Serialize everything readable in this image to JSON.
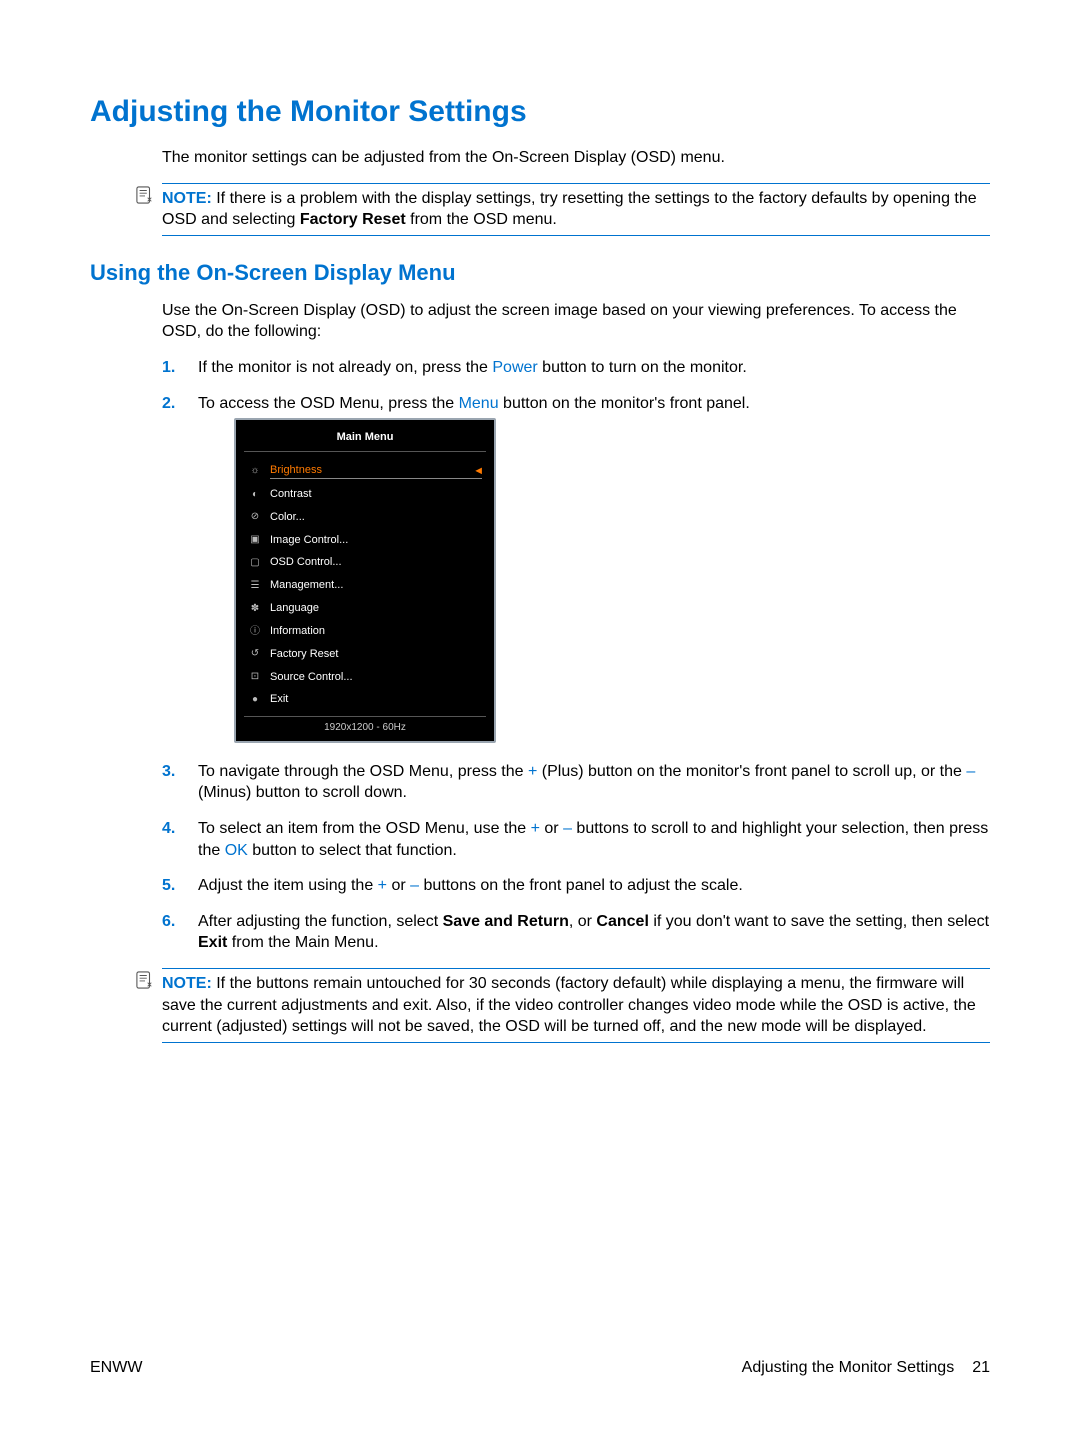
{
  "title": "Adjusting the Monitor Settings",
  "intro": "The monitor settings can be adjusted from the On-Screen Display (OSD) menu.",
  "note1": {
    "label": "NOTE:",
    "segments": [
      {
        "t": "If there is a problem with the display settings, try resetting the settings to the factory defaults by opening the OSD and selecting "
      },
      {
        "t": "Factory Reset",
        "bold": true
      },
      {
        "t": " from the OSD menu."
      }
    ]
  },
  "sub_title": "Using the On-Screen Display Menu",
  "sub_intro": "Use the On-Screen Display (OSD) to adjust the screen image based on your viewing preferences. To access the OSD, do the following:",
  "steps": [
    {
      "n": "1.",
      "segments": [
        {
          "t": "If the monitor is not already on, press the "
        },
        {
          "t": "Power",
          "kw": true
        },
        {
          "t": " button to turn on the monitor."
        }
      ]
    },
    {
      "n": "2.",
      "segments": [
        {
          "t": "To access the OSD Menu, press the "
        },
        {
          "t": "Menu",
          "kw": true
        },
        {
          "t": " button on the monitor's front panel."
        }
      ]
    },
    {
      "n": "3.",
      "segments": [
        {
          "t": "To navigate through the OSD Menu, press the "
        },
        {
          "t": "+",
          "kw": true
        },
        {
          "t": " (Plus) button on the monitor's front panel to scroll up, or the "
        },
        {
          "t": "–",
          "kw": true
        },
        {
          "t": " (Minus) button to scroll down."
        }
      ]
    },
    {
      "n": "4.",
      "segments": [
        {
          "t": "To select an item from the OSD Menu, use the "
        },
        {
          "t": "+",
          "kw": true
        },
        {
          "t": " or "
        },
        {
          "t": "–",
          "kw": true
        },
        {
          "t": " buttons to scroll to and highlight your selection, then press the "
        },
        {
          "t": "OK",
          "kw": true
        },
        {
          "t": " button to select that function."
        }
      ]
    },
    {
      "n": "5.",
      "segments": [
        {
          "t": "Adjust the item using the "
        },
        {
          "t": "+",
          "kw": true
        },
        {
          "t": " or "
        },
        {
          "t": "–",
          "kw": true
        },
        {
          "t": " buttons on the front panel to adjust the scale."
        }
      ]
    },
    {
      "n": "6.",
      "segments": [
        {
          "t": "After adjusting the function, select "
        },
        {
          "t": "Save and Return",
          "bold": true
        },
        {
          "t": ", or "
        },
        {
          "t": "Cancel",
          "bold": true
        },
        {
          "t": " if you don't want to save the setting, then select "
        },
        {
          "t": "Exit",
          "bold": true
        },
        {
          "t": " from the Main Menu."
        }
      ]
    }
  ],
  "osd": {
    "title": "Main Menu",
    "items": [
      {
        "icon": "☼",
        "label": "Brightness",
        "selected": true
      },
      {
        "icon": "◐",
        "label": "Contrast"
      },
      {
        "icon": "⊘",
        "label": "Color..."
      },
      {
        "icon": "▣",
        "label": "Image Control..."
      },
      {
        "icon": "▢",
        "label": "OSD Control..."
      },
      {
        "icon": "☰",
        "label": "Management..."
      },
      {
        "icon": "✽",
        "label": "Language"
      },
      {
        "icon": "ⓘ",
        "label": "Information"
      },
      {
        "icon": "↺",
        "label": "Factory Reset"
      },
      {
        "icon": "⊡",
        "label": "Source Control..."
      },
      {
        "icon": "●",
        "label": "Exit"
      }
    ],
    "footer": "1920x1200 - 60Hz"
  },
  "note2": {
    "label": "NOTE:",
    "text": "If the buttons remain untouched for 30 seconds (factory default) while displaying a menu, the firmware will save the current adjustments and exit. Also, if the video controller changes video mode while the OSD is active, the current (adjusted) settings will not be saved, the OSD will be turned off, and the new mode will be displayed."
  },
  "footer": {
    "left": "ENWW",
    "right_text": "Adjusting the Monitor Settings",
    "page": "21"
  }
}
